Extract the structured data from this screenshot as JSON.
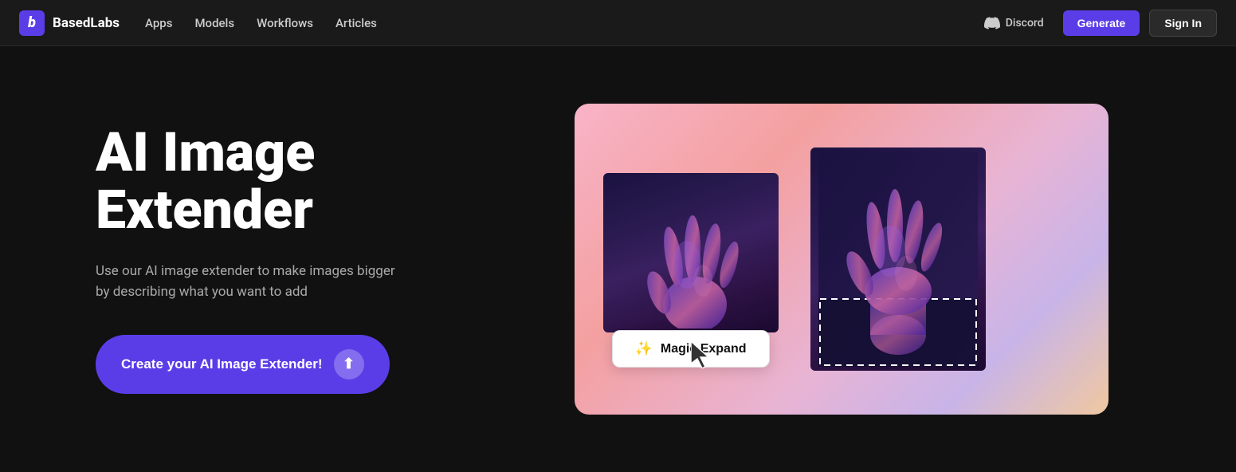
{
  "navbar": {
    "brand": {
      "logo_text": "b",
      "name": "BasedLabs"
    },
    "links": [
      {
        "label": "Apps",
        "id": "apps"
      },
      {
        "label": "Models",
        "id": "models"
      },
      {
        "label": "Workflows",
        "id": "workflows"
      },
      {
        "label": "Articles",
        "id": "articles"
      }
    ],
    "discord_label": "Discord",
    "generate_label": "Generate",
    "signin_label": "Sign In"
  },
  "hero": {
    "title": "AI Image\nExtender",
    "description": "Use our AI image extender to make images bigger by describing what you want to add",
    "cta_label": "Create your AI Image Extender!",
    "magic_expand_label": "Magic Expand"
  },
  "colors": {
    "brand_purple": "#5b3de8",
    "bg_dark": "#111111",
    "navbar_bg": "#1a1a1a"
  }
}
